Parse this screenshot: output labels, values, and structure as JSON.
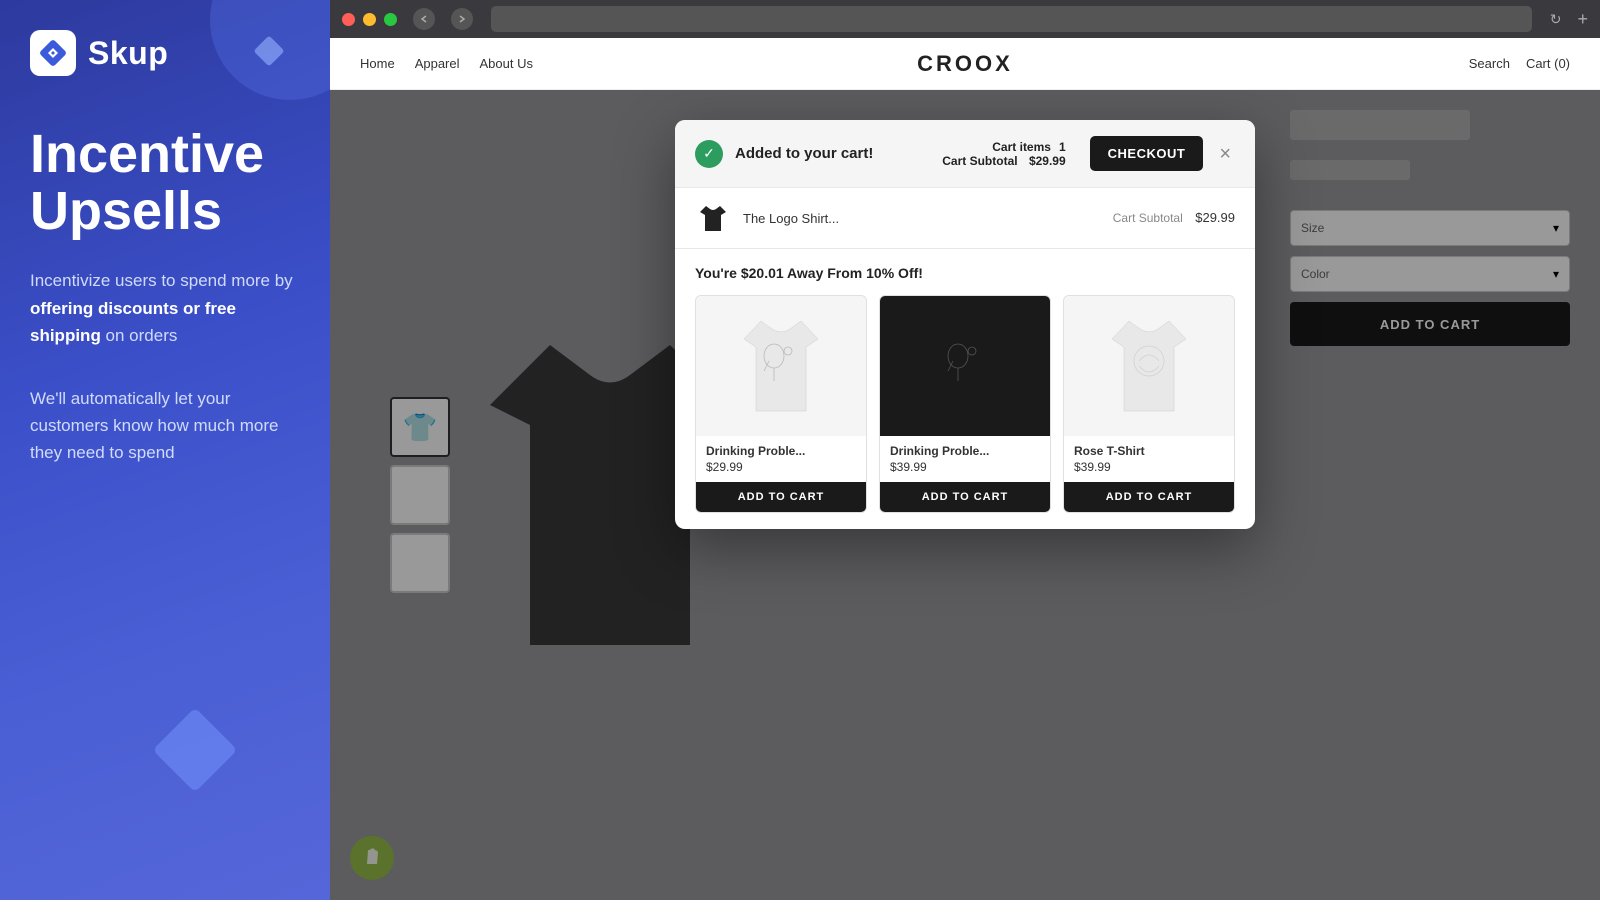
{
  "brand": {
    "name": "Skup",
    "logo_alt": "Skup diamond logo"
  },
  "left_panel": {
    "hero_title": "Incentive\nUpsells",
    "desc1_prefix": "Incentivize users to spend more by ",
    "desc1_bold": "offering discounts or free shipping",
    "desc1_suffix": " on orders",
    "desc2": "We'll automatically let your customers know how much more they need to spend"
  },
  "browser": {
    "nav_items": [
      "Home",
      "Apparel",
      "About Us"
    ],
    "store_brand": "CROOX",
    "nav_right": [
      "Search",
      "Cart (0)"
    ]
  },
  "modal": {
    "added_text": "Added to your cart!",
    "cart_items_label": "Cart items",
    "cart_items_value": "1",
    "cart_subtotal_label": "Cart Subtotal",
    "cart_subtotal_value": "$29.99",
    "checkout_label": "CHECKOUT",
    "product_name": "The Logo Shirt...",
    "upsell_title": "You're $20.01 Away From 10% Off!",
    "products": [
      {
        "name": "Drinking Proble...",
        "price": "$29.99",
        "bg": "white",
        "add_label": "ADD TO CART"
      },
      {
        "name": "Drinking Proble...",
        "price": "$39.99",
        "bg": "black",
        "add_label": "ADD TO CART"
      },
      {
        "name": "Rose T-Shirt",
        "price": "$39.99",
        "bg": "white",
        "add_label": "ADD TO CART"
      }
    ]
  }
}
